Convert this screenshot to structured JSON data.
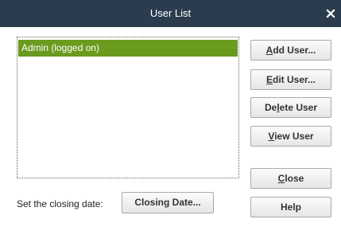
{
  "window": {
    "title": "User List",
    "close_icon": "close-icon"
  },
  "users": {
    "items": [
      {
        "label": "Admin (logged on)",
        "selected": true
      }
    ]
  },
  "buttons": {
    "add_user": {
      "pre": "",
      "mnemonic": "A",
      "post": "dd User..."
    },
    "edit_user": {
      "pre": "",
      "mnemonic": "E",
      "post": "dit User..."
    },
    "delete_user": {
      "pre": "De",
      "mnemonic": "l",
      "post": "ete User"
    },
    "view_user": {
      "pre": "",
      "mnemonic": "V",
      "post": "iew User"
    },
    "close": {
      "pre": "",
      "mnemonic": "C",
      "post": "lose"
    },
    "help": "Help",
    "closing_date": "Closing Date..."
  },
  "closing": {
    "label": "Set the closing date:"
  },
  "colors": {
    "titlebar": "#2b3c4e",
    "selection": "#6a9a1e"
  }
}
